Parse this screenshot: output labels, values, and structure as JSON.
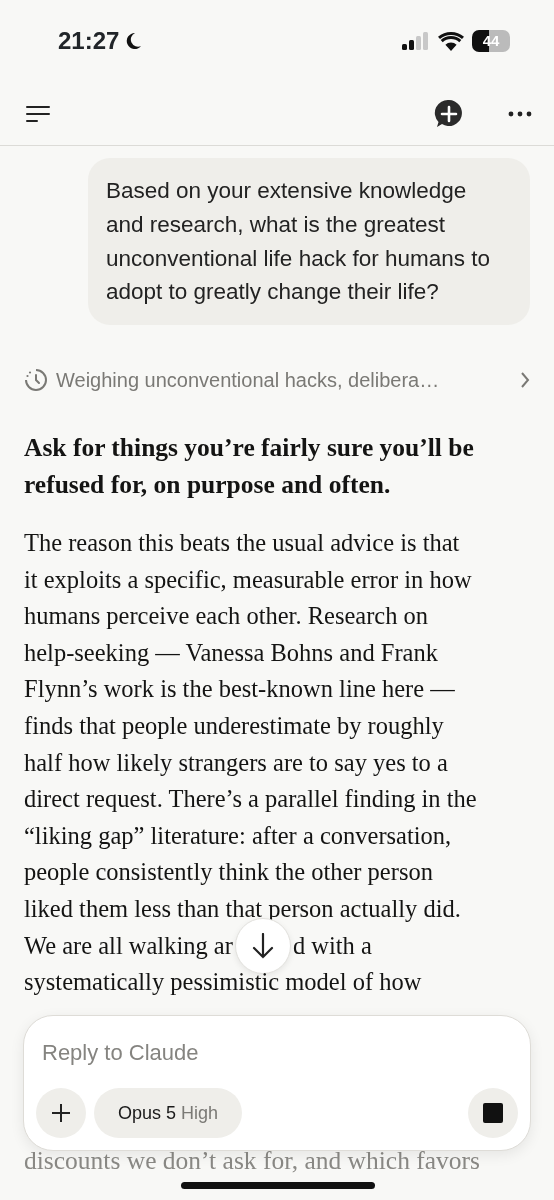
{
  "status_bar": {
    "time": "21:27",
    "battery": "44"
  },
  "conversation": {
    "user_message": "Based on your extensive knowledge and research, what is the greatest unconventional life hack for humans to adopt to greatly change their life?",
    "thinking": {
      "label": "Weighing unconventional hacks, delibera…",
      "expanded": false
    },
    "reply_heading": "Ask for things you’re fairly sure you’ll be refused for, on purpose and often.",
    "reply_lines": [
      {
        "parts": [
          "The reason this beats the usual advice is that"
        ]
      },
      {
        "parts": [
          "it exploits a specific, measurable error in how"
        ]
      },
      {
        "parts": [
          "humans perceive each other. Research on"
        ]
      },
      {
        "parts": [
          "help-seeking — Vanessa Bohns and Frank"
        ]
      },
      {
        "parts": [
          "Flynn’s work is the best-known line here —"
        ]
      },
      {
        "parts": [
          "finds that people underestimate by roughly"
        ]
      },
      {
        "parts": [
          "half how likely strangers are to say yes to a"
        ]
      },
      {
        "parts": [
          "direct request. There’s a parallel finding in the"
        ]
      },
      {
        "parts": [
          "“liking gap” literature: after a conversation,"
        ]
      },
      {
        "parts": [
          "people consistently think the other person"
        ]
      },
      {
        "parts": [
          "liked them less than that person actually did."
        ]
      },
      {
        "parts": [
          "We are all walking ar",
          "d with a"
        ]
      },
      {
        "parts": [
          "systematically pessimistic model of how"
        ]
      }
    ],
    "faded_line": "discounts we don’t ask for, and which favors"
  },
  "composer": {
    "placeholder": "Reply to Claude",
    "model": "Opus 5",
    "effort": "High"
  }
}
